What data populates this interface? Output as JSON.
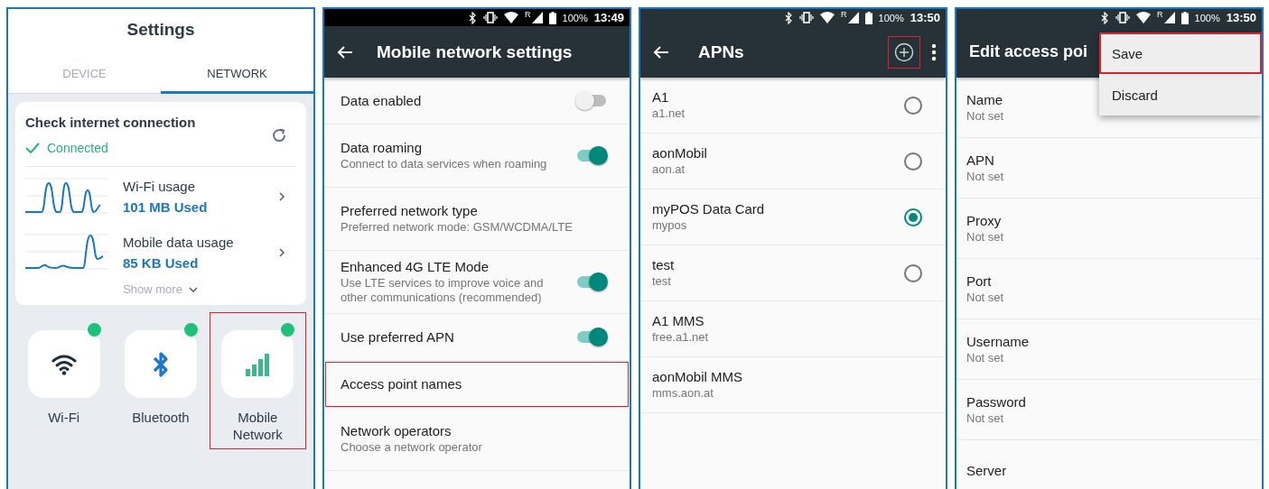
{
  "settings_screen": {
    "title": "Settings",
    "tabs": [
      {
        "label": "DEVICE",
        "selected": false
      },
      {
        "label": "NETWORK",
        "selected": true
      }
    ],
    "connection_card": {
      "title": "Check internet connection",
      "status": "Connected",
      "connected": true,
      "usage": [
        {
          "title": "Wi-Fi usage",
          "value": "101 MB Used",
          "kind": "wifi"
        },
        {
          "title": "Mobile data usage",
          "value": "85 KB Used",
          "kind": "mobile"
        }
      ],
      "show_more": "Show more"
    },
    "tiles": [
      {
        "label": "Wi-Fi",
        "kind": "wifi",
        "active": true,
        "highlighted": false
      },
      {
        "label": "Bluetooth",
        "kind": "bluetooth",
        "active": true,
        "highlighted": false
      },
      {
        "label": "Mobile Network",
        "kind": "mobile",
        "active": true,
        "highlighted": true
      }
    ]
  },
  "mobile_network_screen": {
    "status_bar": {
      "roaming": "R",
      "battery": "100%",
      "time": "13:49"
    },
    "title": "Mobile network settings",
    "rows": [
      {
        "title": "Data enabled",
        "kind": "toggle",
        "on": false,
        "highlighted": false
      },
      {
        "title": "Data roaming",
        "subtitle": "Connect to data services when roaming",
        "kind": "toggle",
        "on": true,
        "highlighted": false
      },
      {
        "title": "Preferred network type",
        "subtitle": "Preferred network mode: GSM/WCDMA/LTE",
        "kind": "link",
        "highlighted": false
      },
      {
        "title": "Enhanced 4G LTE Mode",
        "subtitle": "Use LTE services to improve voice and other communications (recommended)",
        "kind": "toggle",
        "on": true,
        "highlighted": false
      },
      {
        "title": "Use preferred APN",
        "kind": "toggle",
        "on": true,
        "highlighted": false
      },
      {
        "title": "Access point names",
        "kind": "link",
        "highlighted": true
      },
      {
        "title": "Network operators",
        "subtitle": "Choose a network operator",
        "kind": "link",
        "highlighted": false
      }
    ]
  },
  "apn_screen": {
    "status_bar": {
      "roaming": "R",
      "battery": "100%",
      "time": "13:50"
    },
    "title": "APNs",
    "add_highlighted": true,
    "apns": [
      {
        "name": "A1",
        "apn": "a1.net",
        "kind": "radio",
        "selected": false
      },
      {
        "name": "aonMobil",
        "apn": "aon.at",
        "kind": "radio",
        "selected": false
      },
      {
        "name": "myPOS Data Card",
        "apn": "mypos",
        "kind": "radio",
        "selected": true
      },
      {
        "name": "test",
        "apn": "test",
        "kind": "radio",
        "selected": false
      },
      {
        "name": "A1 MMS",
        "apn": "free.a1.net",
        "kind": "plain"
      },
      {
        "name": "aonMobil MMS",
        "apn": "mms.aon.at",
        "kind": "plain"
      }
    ]
  },
  "edit_apn_screen": {
    "status_bar": {
      "roaming": "R",
      "battery": "100%",
      "time": "13:50"
    },
    "title": "Edit access poi",
    "menu": [
      {
        "label": "Save",
        "highlighted": true
      },
      {
        "label": "Discard",
        "highlighted": false
      }
    ],
    "fields": [
      {
        "label": "Name",
        "value": "Not set"
      },
      {
        "label": "APN",
        "value": "Not set"
      },
      {
        "label": "Proxy",
        "value": "Not set"
      },
      {
        "label": "Port",
        "value": "Not set"
      },
      {
        "label": "Username",
        "value": "Not set"
      },
      {
        "label": "Password",
        "value": "Not set"
      },
      {
        "label": "Server"
      }
    ]
  }
}
